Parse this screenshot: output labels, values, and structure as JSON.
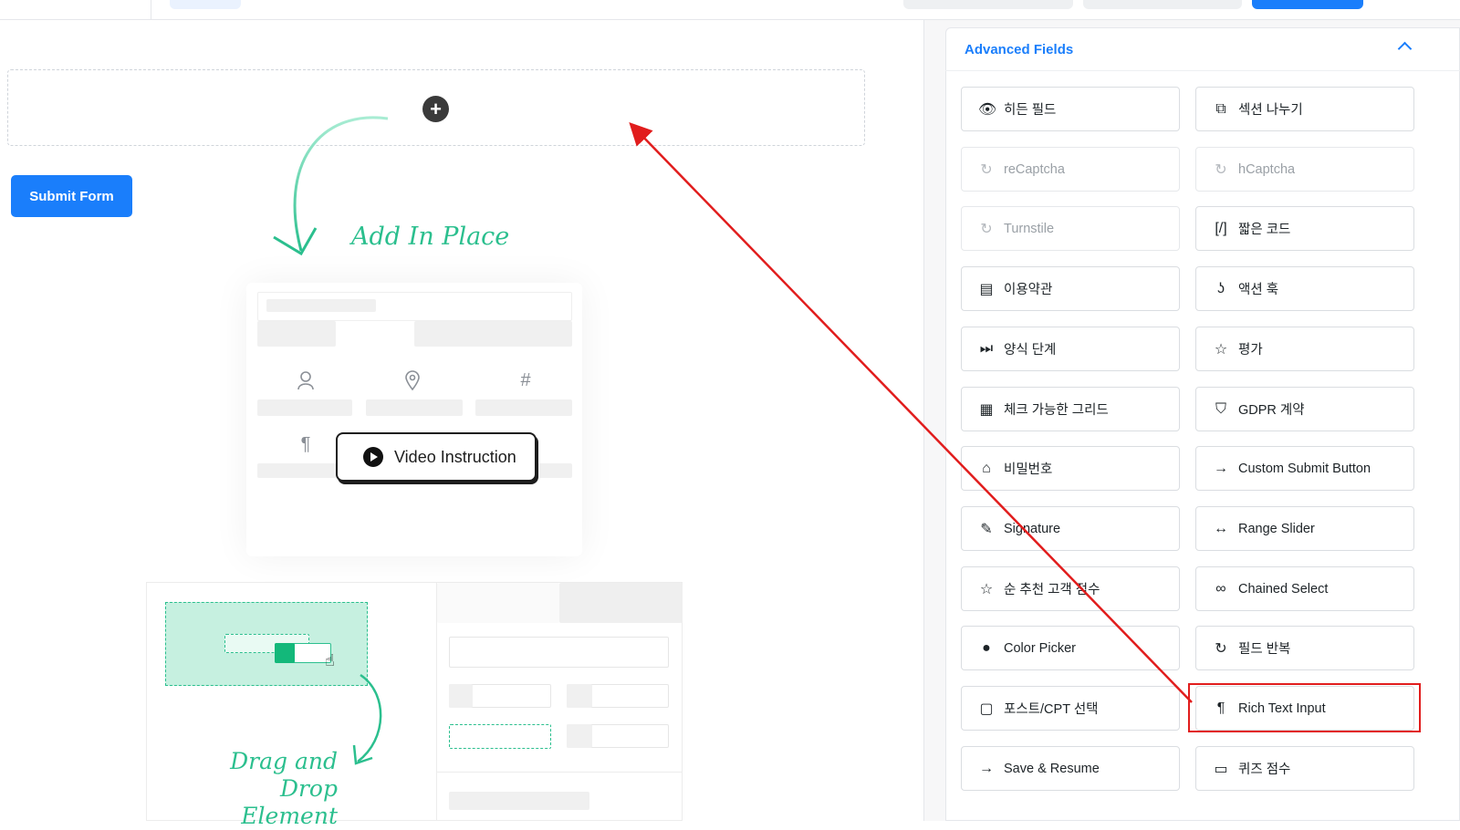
{
  "canvas": {
    "submit_label": "Submit Form",
    "add_in_place": "Add In Place",
    "video_instruction": "Video Instruction",
    "drag_drop_line1": "Drag and Drop",
    "drag_drop_line2": "Element"
  },
  "panel": {
    "title": "Advanced Fields",
    "fields": [
      {
        "label": "히든 필드",
        "icon": "eye-slash-icon",
        "glyph": "👁",
        "disabled": false
      },
      {
        "label": "섹션 나누기",
        "icon": "puzzle-icon",
        "glyph": "⧉",
        "disabled": false
      },
      {
        "label": "reCaptcha",
        "icon": "recaptcha-icon",
        "glyph": "↻",
        "disabled": true
      },
      {
        "label": "hCaptcha",
        "icon": "hcaptcha-icon",
        "glyph": "↻",
        "disabled": true
      },
      {
        "label": "Turnstile",
        "icon": "turnstile-icon",
        "glyph": "↻",
        "disabled": true
      },
      {
        "label": "짧은 코드",
        "icon": "shortcode-icon",
        "glyph": "[/]",
        "disabled": false
      },
      {
        "label": "이용약관",
        "icon": "document-icon",
        "glyph": "▤",
        "disabled": false
      },
      {
        "label": "액션 훅",
        "icon": "hook-icon",
        "glyph": "ʖ",
        "disabled": false
      },
      {
        "label": "양식 단계",
        "icon": "step-forward-icon",
        "glyph": "⏭",
        "disabled": false
      },
      {
        "label": "평가",
        "icon": "star-icon",
        "glyph": "☆",
        "disabled": false
      },
      {
        "label": "체크 가능한 그리드",
        "icon": "grid-check-icon",
        "glyph": "▦",
        "disabled": false
      },
      {
        "label": "GDPR 계약",
        "icon": "shield-icon",
        "glyph": "⛉",
        "disabled": false
      },
      {
        "label": "비밀번호",
        "icon": "lock-icon",
        "glyph": "⌂",
        "disabled": false
      },
      {
        "label": "Custom Submit Button",
        "icon": "arrow-right-icon",
        "glyph": "→",
        "disabled": false
      },
      {
        "label": "Signature",
        "icon": "pen-icon",
        "glyph": "✎",
        "disabled": false
      },
      {
        "label": "Range Slider",
        "icon": "range-slider-icon",
        "glyph": "↔",
        "disabled": false
      },
      {
        "label": "순 추천 고객 점수",
        "icon": "star-outline-icon",
        "glyph": "☆",
        "disabled": false
      },
      {
        "label": "Chained Select",
        "icon": "chain-link-icon",
        "glyph": "∞",
        "disabled": false
      },
      {
        "label": "Color Picker",
        "icon": "color-drop-icon",
        "glyph": "●",
        "disabled": false
      },
      {
        "label": "필드 반복",
        "icon": "repeat-icon",
        "glyph": "↻",
        "disabled": false
      },
      {
        "label": "포스트/CPT 선택",
        "icon": "post-select-icon",
        "glyph": "▢",
        "disabled": false
      },
      {
        "label": "Rich Text Input",
        "icon": "pilcrow-icon",
        "glyph": "¶",
        "disabled": false
      },
      {
        "label": "Save & Resume",
        "icon": "arrow-right-icon",
        "glyph": "→",
        "disabled": false
      },
      {
        "label": "퀴즈 점수",
        "icon": "quiz-score-icon",
        "glyph": "▭",
        "disabled": false
      }
    ]
  },
  "colors": {
    "accent": "#1a7efb",
    "handwriting": "#2bbf8e",
    "annotation": "#e11d1d"
  }
}
